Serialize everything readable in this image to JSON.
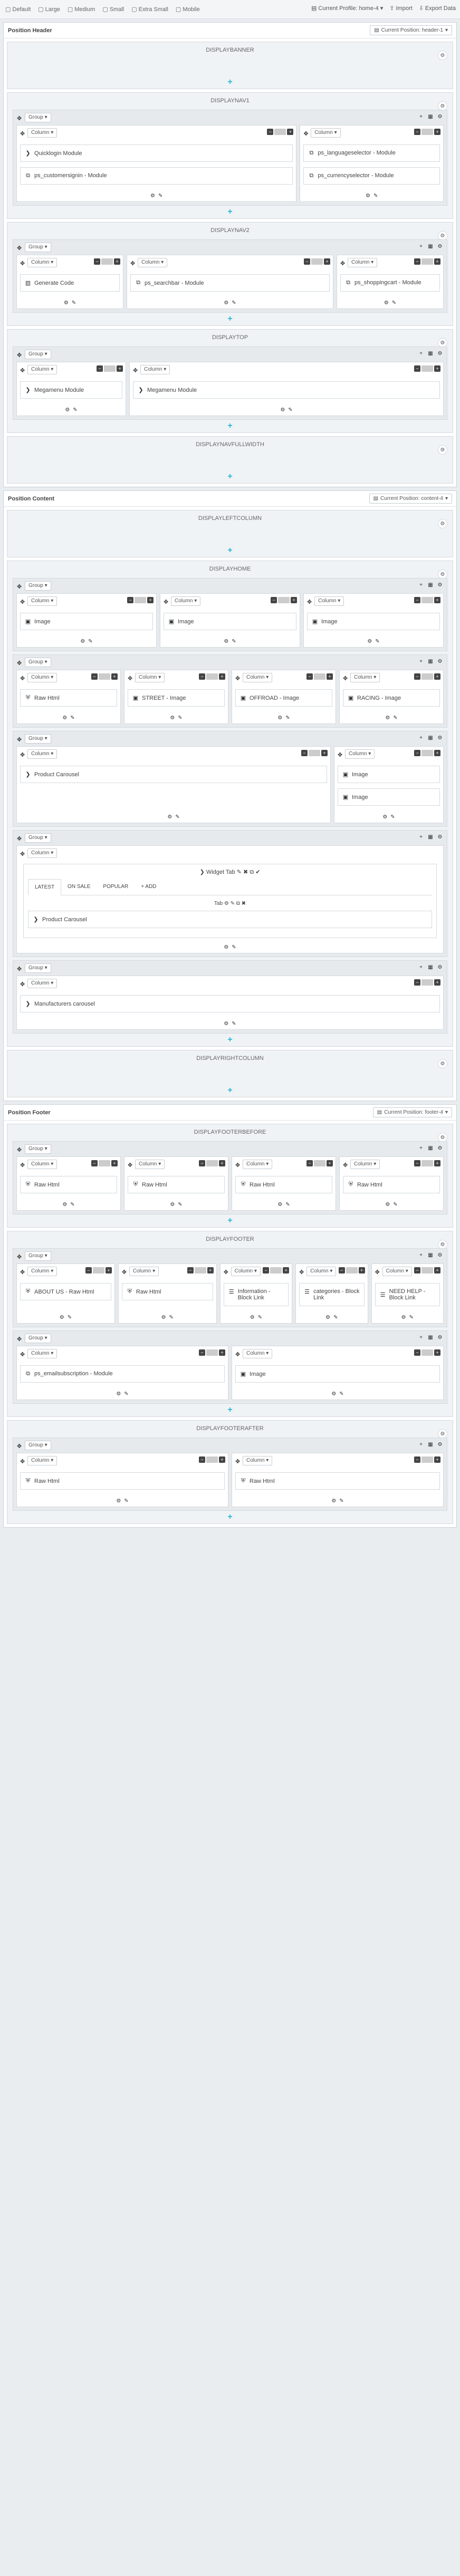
{
  "topbar": {
    "devices": [
      "Default",
      "Large",
      "Medium",
      "Small",
      "Extra Small",
      "Mobile"
    ],
    "current_profile": "Current Profile: home-4",
    "import": "Import",
    "export": "Export Data"
  },
  "labels": {
    "group": "Group",
    "column": "Column",
    "cplabel": "Current Position:"
  },
  "positions": [
    {
      "title": "Position Header",
      "current": "Current Position: header-1",
      "hooks": [
        {
          "title": "DISPLAYBANNER",
          "groups": []
        },
        {
          "title": "DISPLAYNAV1",
          "groups": [
            {
              "cols": [
                {
                  "flex": 2,
                  "items": [
                    {
                      "icon": "chevron",
                      "text": "Quicklogin Module"
                    },
                    {
                      "icon": "module",
                      "text": "ps_customersignin - Module"
                    }
                  ]
                },
                {
                  "flex": 1,
                  "items": [
                    {
                      "icon": "module",
                      "text": "ps_languageselector - Module"
                    },
                    {
                      "icon": "module",
                      "text": "ps_currencyselector - Module"
                    }
                  ]
                }
              ]
            }
          ]
        },
        {
          "title": "DISPLAYNAV2",
          "groups": [
            {
              "cols": [
                {
                  "flex": 1,
                  "items": [
                    {
                      "icon": "code",
                      "text": "Generate Code"
                    }
                  ]
                },
                {
                  "flex": 2,
                  "items": [
                    {
                      "icon": "module",
                      "text": "ps_searchbar - Module"
                    }
                  ]
                },
                {
                  "flex": 1,
                  "items": [
                    {
                      "icon": "module",
                      "text": "ps_shoppingcart - Module"
                    }
                  ]
                }
              ]
            }
          ]
        },
        {
          "title": "DISPLAYTOP",
          "groups": [
            {
              "cols": [
                {
                  "flex": 1,
                  "items": [
                    {
                      "icon": "chevron",
                      "text": "Megamenu Module"
                    }
                  ]
                },
                {
                  "flex": 3,
                  "items": [
                    {
                      "icon": "chevron",
                      "text": "Megamenu Module"
                    }
                  ]
                }
              ]
            }
          ]
        },
        {
          "title": "DISPLAYNAVFULLWIDTH",
          "groups": []
        }
      ]
    },
    {
      "title": "Position Content",
      "current": "Current Position: content-4",
      "hooks": [
        {
          "title": "DISPLAYLEFTCOLUMN",
          "groups": []
        },
        {
          "title": "DISPLAYHOME",
          "groups": [
            {
              "cols": [
                {
                  "flex": 1,
                  "items": [
                    {
                      "icon": "image",
                      "text": "Image"
                    }
                  ]
                },
                {
                  "flex": 1,
                  "items": [
                    {
                      "icon": "image",
                      "text": "Image"
                    }
                  ]
                },
                {
                  "flex": 1,
                  "items": [
                    {
                      "icon": "image",
                      "text": "Image"
                    }
                  ]
                }
              ]
            },
            {
              "cols": [
                {
                  "flex": 1,
                  "items": [
                    {
                      "icon": "shield",
                      "text": "Raw Html"
                    }
                  ]
                },
                {
                  "flex": 1,
                  "items": [
                    {
                      "icon": "image",
                      "text": "STREET - Image"
                    }
                  ]
                },
                {
                  "flex": 1,
                  "items": [
                    {
                      "icon": "image",
                      "text": "OFFROAD - Image"
                    }
                  ]
                },
                {
                  "flex": 1,
                  "items": [
                    {
                      "icon": "image",
                      "text": "RACING - Image"
                    }
                  ]
                }
              ]
            },
            {
              "cols": [
                {
                  "flex": 3,
                  "items": [
                    {
                      "icon": "chevron",
                      "text": "Product Carousel"
                    }
                  ]
                },
                {
                  "flex": 1,
                  "items": [
                    {
                      "icon": "image",
                      "text": "Image"
                    },
                    {
                      "icon": "image",
                      "text": "Image"
                    }
                  ]
                }
              ]
            },
            {
              "widget": true,
              "widget_title": "Widget Tab",
              "tabs": [
                "LATEST",
                "ON SALE",
                "POPULAR",
                "ADD"
              ],
              "tab_label": "Tab",
              "item": "Product Carousel"
            },
            {
              "cols": [
                {
                  "flex": 1,
                  "items": [
                    {
                      "icon": "chevron",
                      "text": "Manufacturers carousel"
                    }
                  ]
                }
              ]
            }
          ]
        },
        {
          "title": "DISPLAYRIGHTCOLUMN",
          "groups": []
        }
      ]
    },
    {
      "title": "Position Footer",
      "current": "Current Position: footer-4",
      "hooks": [
        {
          "title": "DISPLAYFOOTERBEFORE",
          "groups": [
            {
              "cols": [
                {
                  "flex": 1,
                  "items": [
                    {
                      "icon": "shield",
                      "text": "Raw Html"
                    }
                  ]
                },
                {
                  "flex": 1,
                  "items": [
                    {
                      "icon": "shield",
                      "text": "Raw Html"
                    }
                  ]
                },
                {
                  "flex": 1,
                  "items": [
                    {
                      "icon": "shield",
                      "text": "Raw Html"
                    }
                  ]
                },
                {
                  "flex": 1,
                  "items": [
                    {
                      "icon": "shield",
                      "text": "Raw Html"
                    }
                  ]
                }
              ]
            }
          ]
        },
        {
          "title": "DISPLAYFOOTER",
          "groups": [
            {
              "cols": [
                {
                  "flex": 1.4,
                  "items": [
                    {
                      "icon": "shield",
                      "text": "ABOUT US - Raw Html"
                    }
                  ]
                },
                {
                  "flex": 1.4,
                  "items": [
                    {
                      "icon": "shield",
                      "text": "Raw Html"
                    }
                  ]
                },
                {
                  "flex": 1,
                  "items": [
                    {
                      "icon": "list",
                      "text": "Information - Block Link"
                    }
                  ]
                },
                {
                  "flex": 1,
                  "items": [
                    {
                      "icon": "list",
                      "text": "categories - Block Link"
                    }
                  ]
                },
                {
                  "flex": 1,
                  "items": [
                    {
                      "icon": "list",
                      "text": "NEED HELP - Block Link"
                    }
                  ]
                }
              ]
            },
            {
              "cols": [
                {
                  "flex": 1,
                  "items": [
                    {
                      "icon": "module",
                      "text": "ps_emailsubscription - Module"
                    }
                  ]
                },
                {
                  "flex": 1,
                  "items": [
                    {
                      "icon": "image",
                      "text": "Image"
                    }
                  ]
                }
              ]
            }
          ]
        },
        {
          "title": "DISPLAYFOOTERAFTER",
          "groups": [
            {
              "cols": [
                {
                  "flex": 1,
                  "items": [
                    {
                      "icon": "shield",
                      "text": "Raw Html"
                    }
                  ]
                },
                {
                  "flex": 1,
                  "items": [
                    {
                      "icon": "shield",
                      "text": "Raw Html"
                    }
                  ]
                }
              ]
            }
          ]
        }
      ]
    }
  ]
}
